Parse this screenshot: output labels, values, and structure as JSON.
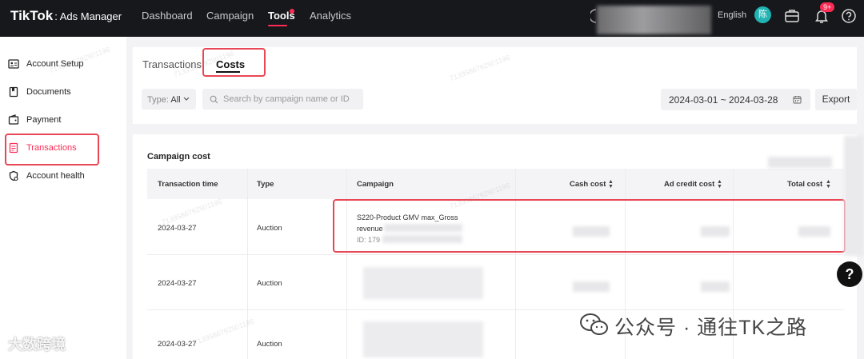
{
  "app": {
    "brand": "TikTok",
    "brand_sub": "Ads Manager"
  },
  "nav": [
    {
      "label": "Dashboard"
    },
    {
      "label": "Campaign"
    },
    {
      "label": "Tools"
    },
    {
      "label": "Analytics"
    }
  ],
  "topbar": {
    "language": "English",
    "avatar": "陈",
    "notification_badge": "9+",
    "help_glyph": "?"
  },
  "sidebar": {
    "items": [
      {
        "label": "Account Setup",
        "icon": "id-card-icon"
      },
      {
        "label": "Documents",
        "icon": "document-icon"
      },
      {
        "label": "Payment",
        "icon": "wallet-icon"
      },
      {
        "label": "Transactions",
        "icon": "receipt-icon"
      },
      {
        "label": "Account health",
        "icon": "shield-health-icon"
      }
    ]
  },
  "tabs": [
    {
      "label": "Transactions"
    },
    {
      "label": "Costs"
    }
  ],
  "filters": {
    "type_label": "Type:",
    "type_value": "All",
    "search_placeholder": "Search by campaign name or ID",
    "date_range": "2024-03-01 ~ 2024-03-28",
    "export_label": "Export"
  },
  "campaign_cost": {
    "title": "Campaign cost",
    "columns": [
      "Transaction time",
      "Type",
      "Campaign",
      "Cash cost",
      "Ad credit cost",
      "Total cost"
    ],
    "rows": [
      {
        "time": "2024-03-27",
        "type": "Auction",
        "campaign": "S220-Product GMV max_Gross",
        "campaign_line2": "revenue",
        "campaign_id": "ID: 179"
      },
      {
        "time": "2024-03-27",
        "type": "Auction"
      },
      {
        "time": "2024-03-27",
        "type": "Auction"
      }
    ]
  },
  "watermark": {
    "left": "大数跨境",
    "right": "公众号 · 通往TK之路",
    "pattern": "7139586792501196"
  },
  "colors": {
    "accent": "#fe2c55",
    "highlight_box": "#e84855",
    "topbar": "#17181c"
  }
}
